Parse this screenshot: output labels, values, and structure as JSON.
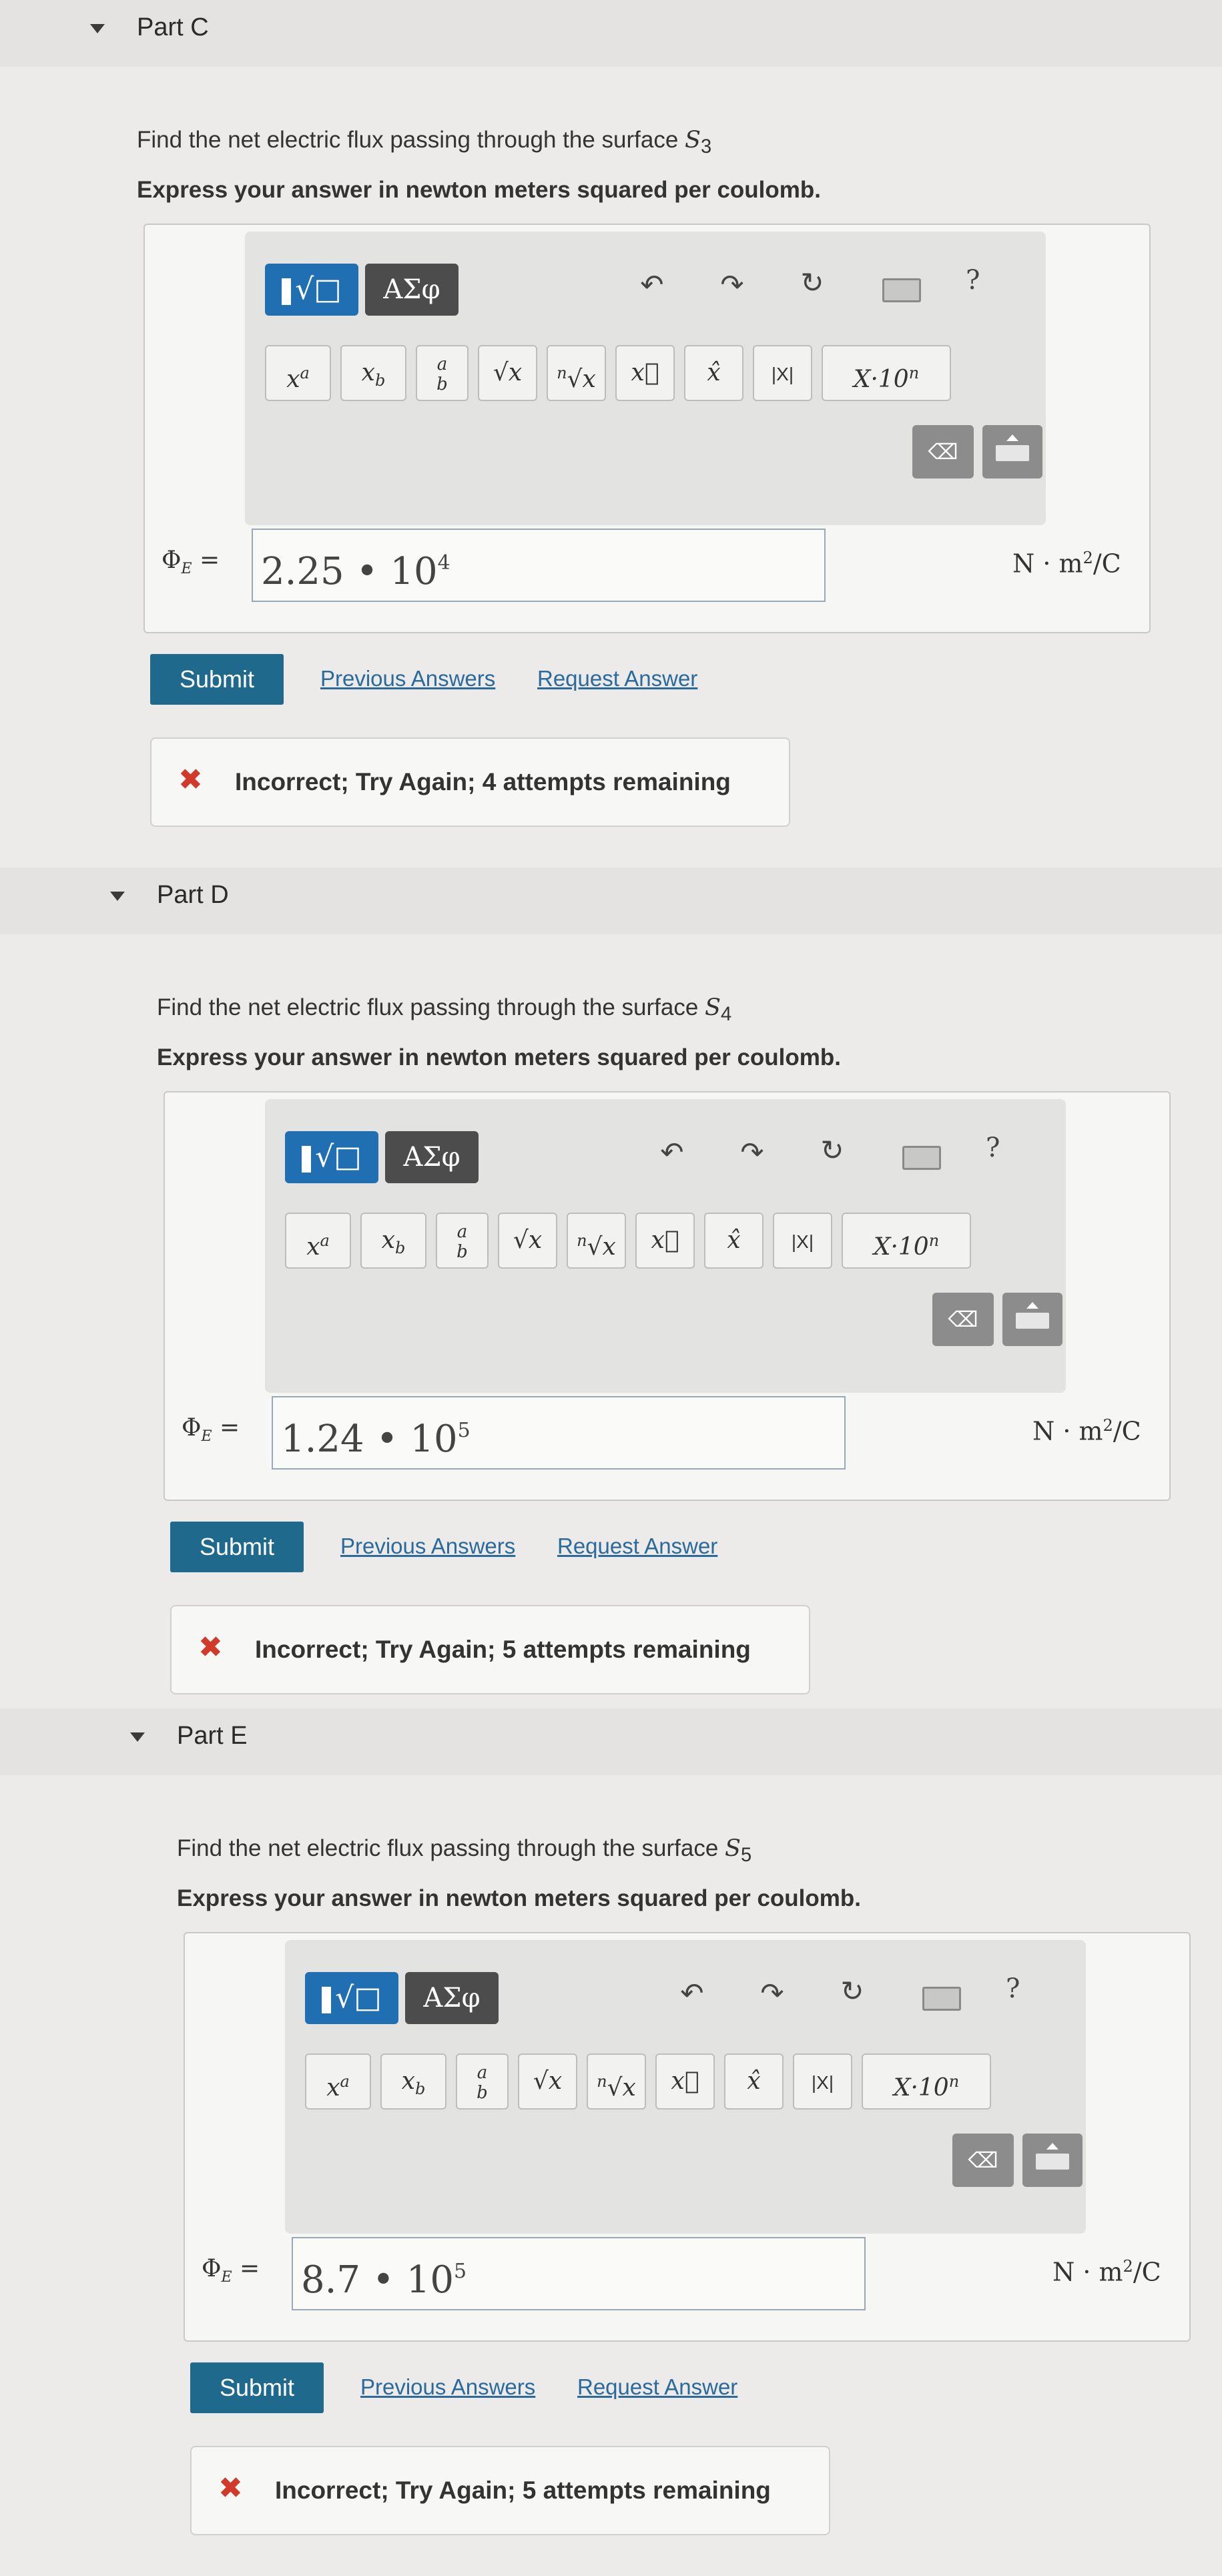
{
  "toolbar": {
    "template_label": "√□",
    "greek_label": "ΑΣφ",
    "undo_icon": "undo-icon",
    "redo_icon": "redo-icon",
    "reset_icon": "reset-icon",
    "help_label": "?",
    "keys": [
      "xa",
      "xb",
      "a/b",
      "√x",
      "ⁿ√x",
      "x⃗",
      "x̂",
      "|X|",
      "X·10n"
    ],
    "backspace_label": "⌫"
  },
  "parts": [
    {
      "title": "Part C",
      "question_prefix": "Find the net electric flux passing through the surface",
      "surface": "S",
      "surface_sub": "3",
      "instruction": "Express your answer in newton meters squared per coulomb.",
      "phi_label": "Φ",
      "phi_sub": "E",
      "equals": "=",
      "answer_mantissa": "2.25 • 10",
      "answer_exp": "4",
      "units_prefix": "N · m",
      "units_exp": "2",
      "units_suffix": "/C",
      "submit_label": "Submit",
      "previous_answers": "Previous Answers",
      "request_answer": "Request Answer",
      "feedback": "Incorrect; Try Again; 4 attempts remaining"
    },
    {
      "title": "Part D",
      "question_prefix": "Find the net electric flux passing through the surface",
      "surface": "S",
      "surface_sub": "4",
      "instruction": "Express your answer in newton meters squared per coulomb.",
      "phi_label": "Φ",
      "phi_sub": "E",
      "equals": "=",
      "answer_mantissa": "1.24 • 10",
      "answer_exp": "5",
      "units_prefix": "N · m",
      "units_exp": "2",
      "units_suffix": "/C",
      "submit_label": "Submit",
      "previous_answers": "Previous Answers",
      "request_answer": "Request Answer",
      "feedback": "Incorrect; Try Again; 5 attempts remaining"
    },
    {
      "title": "Part E",
      "question_prefix": "Find the net electric flux passing through the surface",
      "surface": "S",
      "surface_sub": "5",
      "instruction": "Express your answer in newton meters squared per coulomb.",
      "phi_label": "Φ",
      "phi_sub": "E",
      "equals": "=",
      "answer_mantissa": "8.7 • 10",
      "answer_exp": "5",
      "units_prefix": "N · m",
      "units_exp": "2",
      "units_suffix": "/C",
      "submit_label": "Submit",
      "previous_answers": "Previous Answers",
      "request_answer": "Request Answer",
      "feedback": "Incorrect; Try Again; 5 attempts remaining"
    }
  ]
}
